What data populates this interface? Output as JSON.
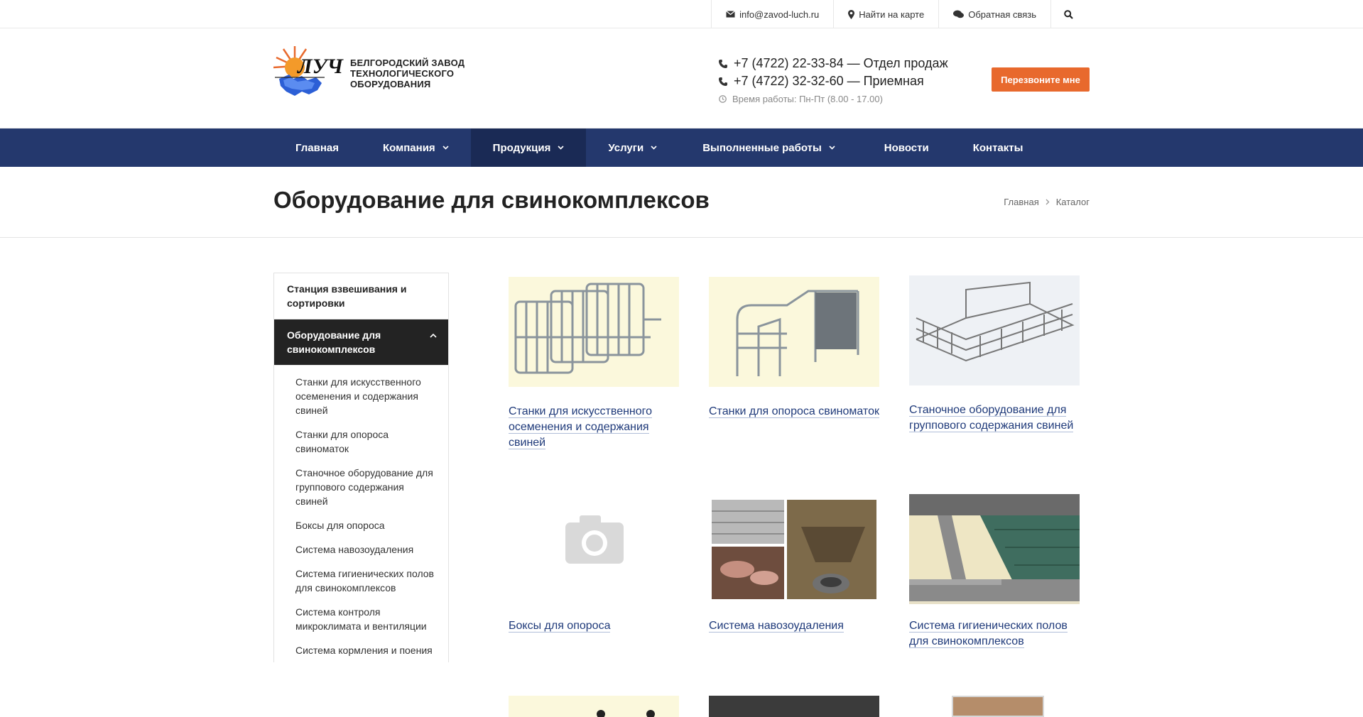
{
  "topbar": {
    "email": "info@zavod-luch.ru",
    "map": "Найти на карте",
    "feedback": "Обратная связь"
  },
  "header": {
    "logo_word": "ЛУЧ",
    "logo_text": [
      "БЕЛГОРОДСКИЙ ЗАВОД",
      "ТЕХНОЛОГИЧЕСКОГО",
      "ОБОРУДОВАНИЯ"
    ],
    "phone1": "+7 (4722) 22-33-84 — Отдел продаж",
    "phone2": "+7 (4722) 32-32-60 — Приемная",
    "hours": "Время работы: Пн-Пт (8.00 - 17.00)",
    "callback": "Перезвоните мне"
  },
  "nav": [
    {
      "label": "Главная",
      "dropdown": false,
      "active": false
    },
    {
      "label": "Компания",
      "dropdown": true,
      "active": false
    },
    {
      "label": "Продукция",
      "dropdown": true,
      "active": true
    },
    {
      "label": "Услуги",
      "dropdown": true,
      "active": false
    },
    {
      "label": "Выполненные работы",
      "dropdown": true,
      "active": false
    },
    {
      "label": "Новости",
      "dropdown": false,
      "active": false
    },
    {
      "label": "Контакты",
      "dropdown": false,
      "active": false
    }
  ],
  "page": {
    "title": "Оборудование для свинокомплексов",
    "breadcrumb": [
      "Главная",
      "Каталог"
    ]
  },
  "sidebar": {
    "top": "Станция взвешивания и сортировки",
    "active": "Оборудование для свинокомплексов",
    "sub": [
      "Станки для искусственного осеменения и содержания свиней",
      "Станки для опороса свиноматок",
      "Станочное оборудование для группового содержания свиней",
      "Боксы для опороса",
      "Система навозоудаления",
      "Система гигиенических полов для свинокомплексов",
      "Система контроля микроклимата и вентиляции",
      "Система кормления и поения"
    ]
  },
  "products": [
    {
      "caption": "Станки для искусственного осеменения и содержания свиней"
    },
    {
      "caption": "Станки для опороса свиноматок"
    },
    {
      "caption": "Станочное оборудование для группового содержания свиней"
    },
    {
      "caption": "Боксы для опороса"
    },
    {
      "caption": "Система навозоудаления"
    },
    {
      "caption": "Система гигиенических полов для свинокомплексов"
    }
  ],
  "colors": {
    "nav_bg": "#24386d",
    "nav_active": "#1a2a55",
    "accent": "#e8692d",
    "link": "#1f3a7a"
  }
}
